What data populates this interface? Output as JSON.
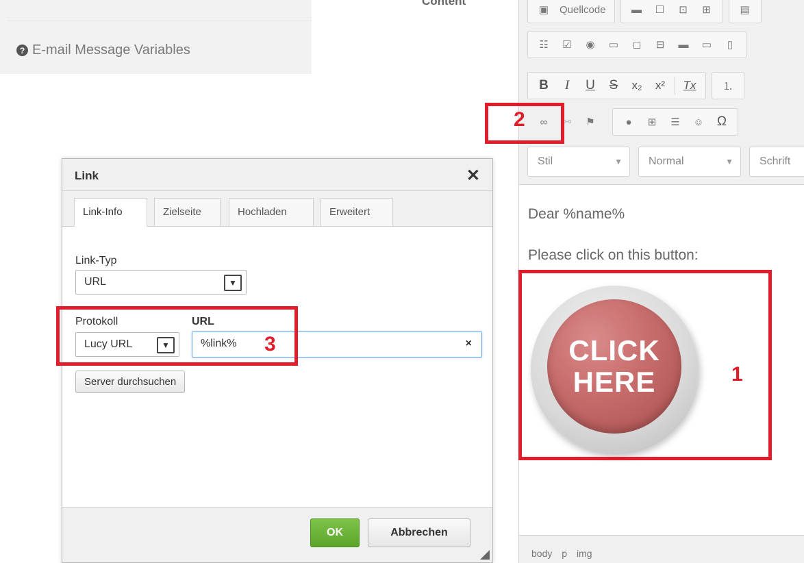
{
  "left_panel": {
    "variables_link": "E-mail Message Variables",
    "content_label": "Content"
  },
  "editor": {
    "toolbar": {
      "source_label": "Quellcode",
      "bold": "B",
      "italic": "I",
      "underline": "U",
      "strike": "S",
      "subscript": "x₂",
      "superscript": "x²",
      "clear_format": "Tx",
      "style_combo": "Stil",
      "format_combo": "Normal",
      "font_combo": "Schrift"
    },
    "content": {
      "greeting": "Dear %name%",
      "instruction": "Please click on this button:",
      "button_line1": "CLICK",
      "button_line2": "HERE"
    },
    "path": [
      "body",
      "p",
      "img"
    ]
  },
  "annotations": {
    "one": "1",
    "two": "2",
    "three": "3",
    "color": "#e01e2b"
  },
  "dialog": {
    "title": "Link",
    "close": "✕",
    "tabs": [
      "Link-Info",
      "Zielseite",
      "Hochladen",
      "Erweitert"
    ],
    "link_type_label": "Link-Typ",
    "link_type_value": "URL",
    "protocol_label": "Protokoll",
    "protocol_value": "Lucy URL",
    "url_label": "URL",
    "url_value": "%link%",
    "clear": "×",
    "browse_button": "Server durchsuchen",
    "ok_button": "OK",
    "cancel_button": "Abbrechen"
  }
}
